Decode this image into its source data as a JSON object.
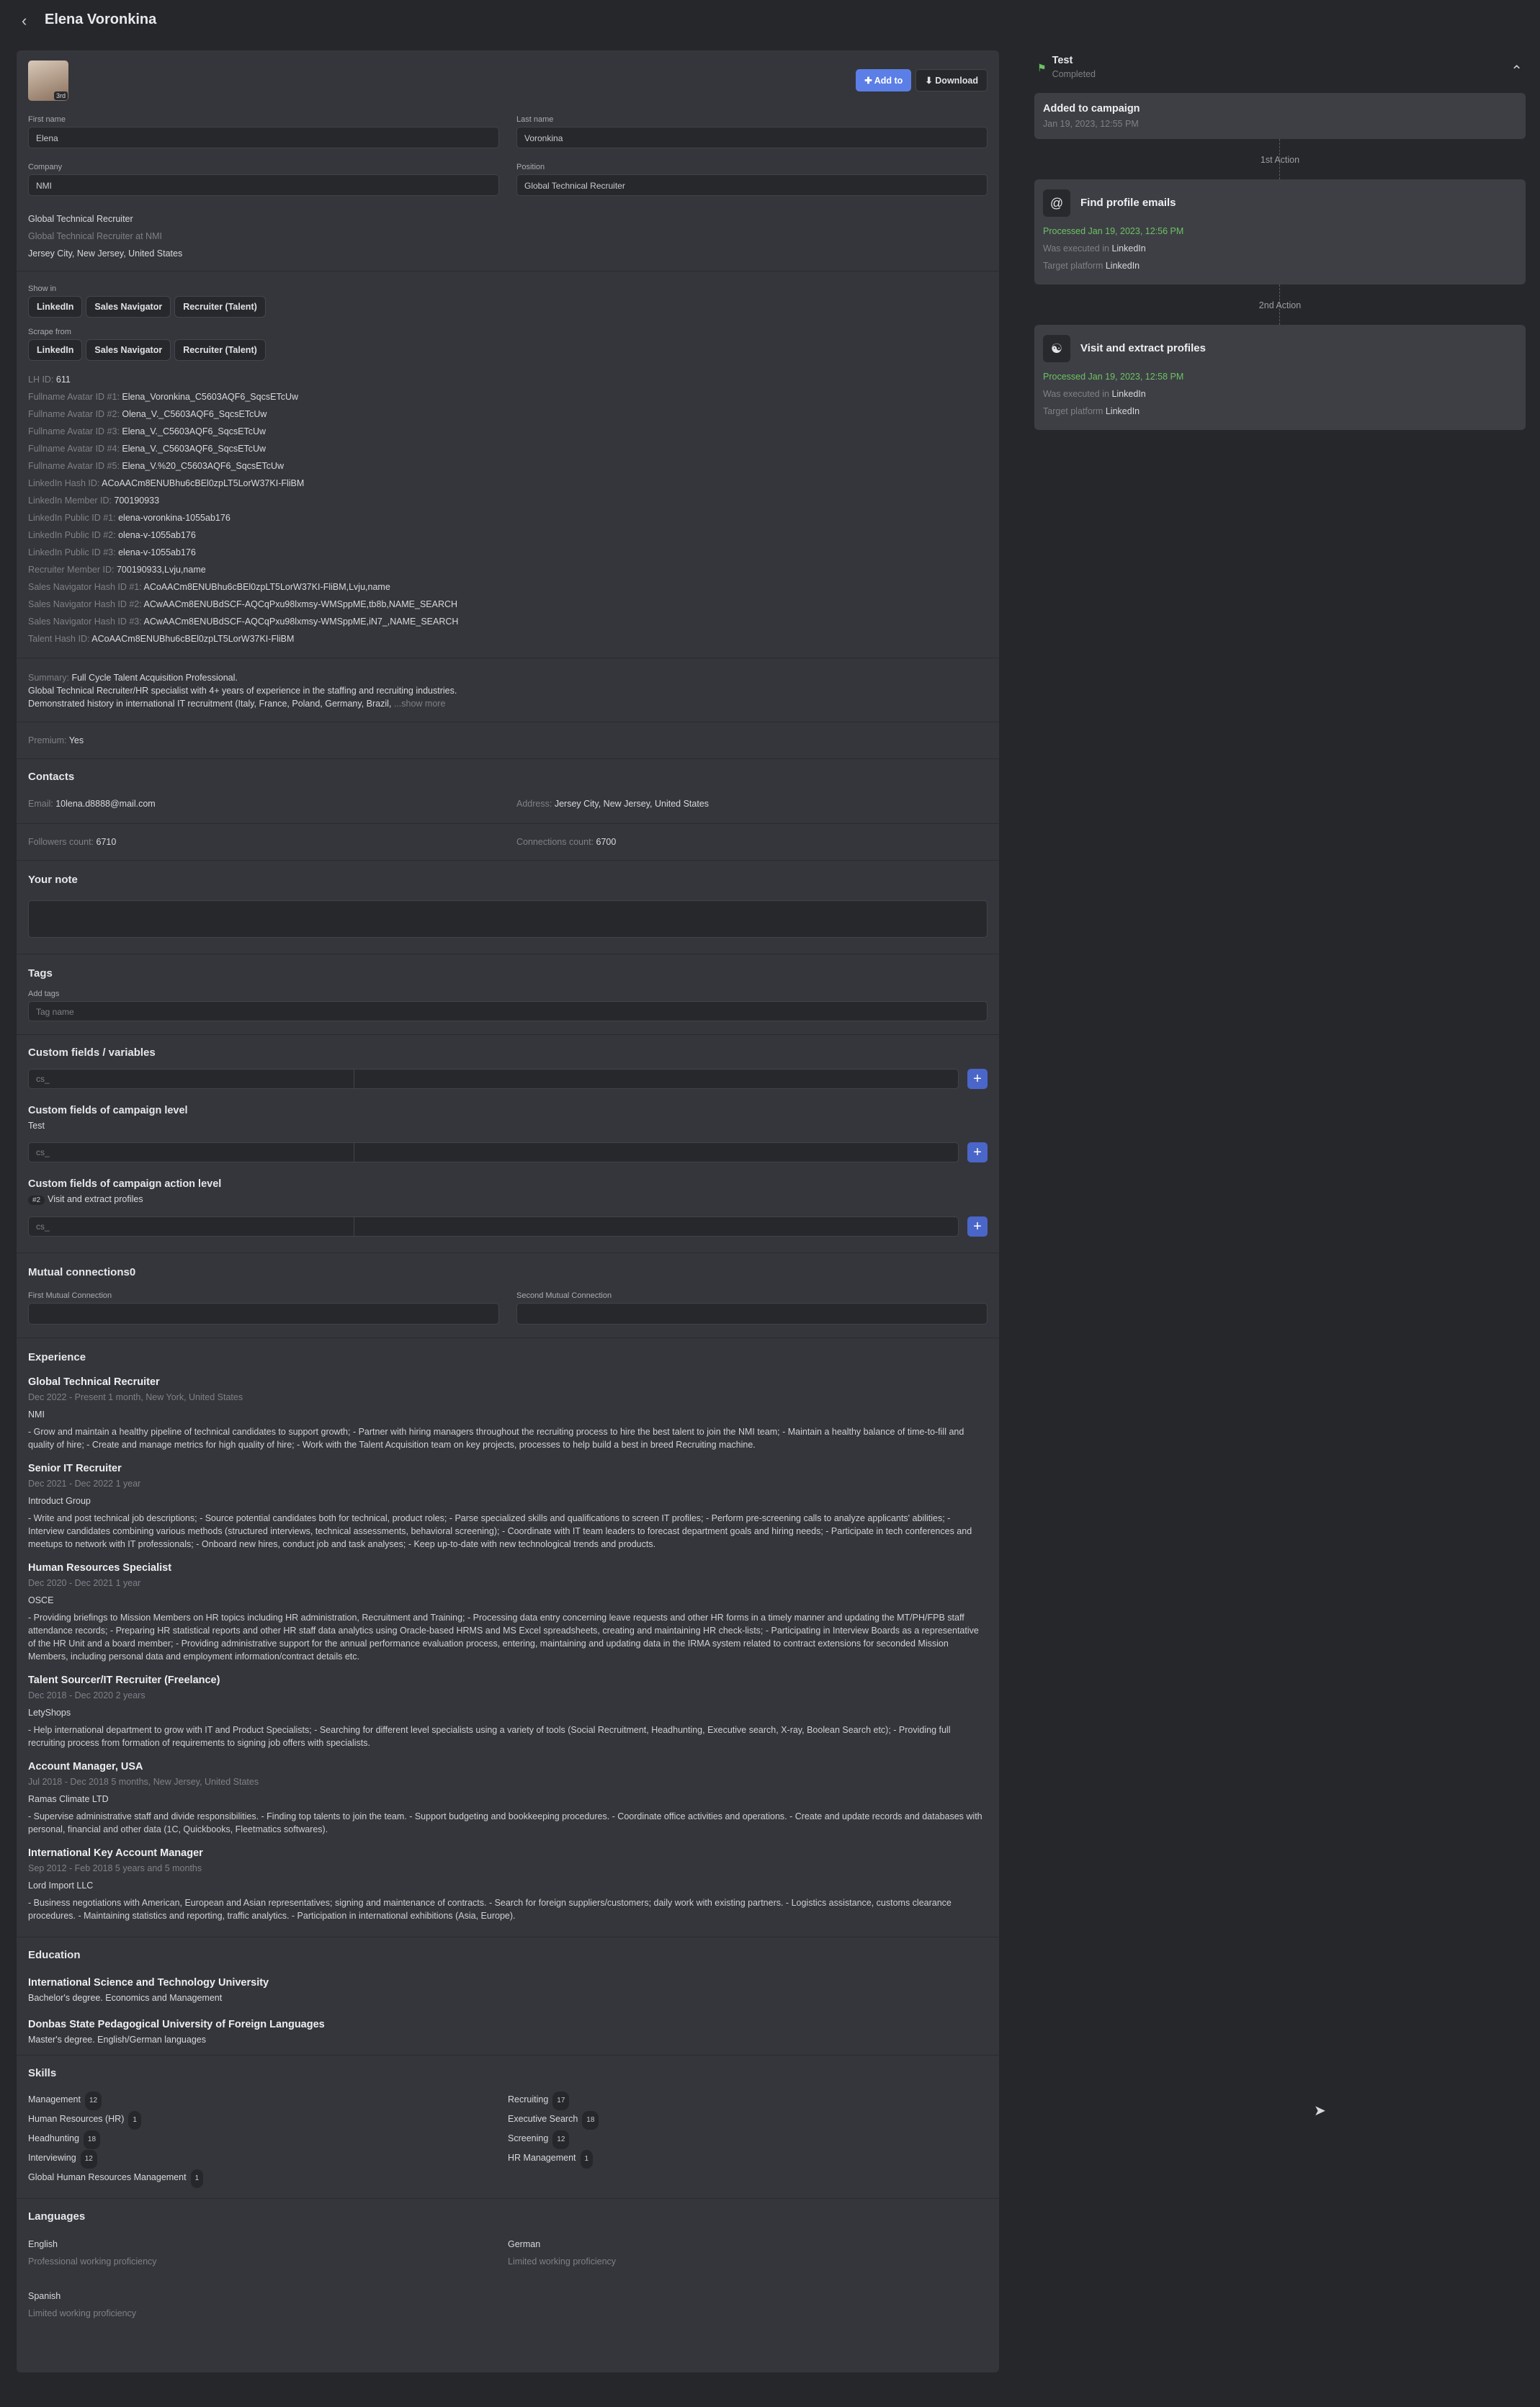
{
  "header": {
    "title": "Elena Voronkina"
  },
  "profile": {
    "degree": "3rd",
    "add_label": "Add to",
    "download_label": "Download",
    "first_name_label": "First name",
    "first_name": "Elena",
    "last_name_label": "Last name",
    "last_name": "Voronkina",
    "company_label": "Company",
    "company": "NMI",
    "position_label": "Position",
    "position": "Global Technical Recruiter",
    "headline": "Global Technical Recruiter",
    "headline_sub": "Global Technical Recruiter at NMI",
    "location": "Jersey City, New Jersey, United States"
  },
  "show_in": {
    "label": "Show in",
    "chips": [
      "LinkedIn",
      "Sales Navigator",
      "Recruiter (Talent)"
    ]
  },
  "scrape_from": {
    "label": "Scrape from",
    "chips": [
      "LinkedIn",
      "Sales Navigator",
      "Recruiter (Talent)"
    ]
  },
  "ids": [
    {
      "k": "LH ID:",
      "v": "611"
    },
    {
      "k": "Fullname Avatar ID #1:",
      "v": "Elena_Voronkina_C5603AQF6_SqcsETcUw"
    },
    {
      "k": "Fullname Avatar ID #2:",
      "v": "Olena_V._C5603AQF6_SqcsETcUw"
    },
    {
      "k": "Fullname Avatar ID #3:",
      "v": "Elena_V._C5603AQF6_SqcsETcUw"
    },
    {
      "k": "Fullname Avatar ID #4:",
      "v": "Elena_V._C5603AQF6_SqcsETcUw"
    },
    {
      "k": "Fullname Avatar ID #5:",
      "v": "Elena_V.%20_C5603AQF6_SqcsETcUw"
    },
    {
      "k": "LinkedIn Hash ID:",
      "v": "ACoAACm8ENUBhu6cBEl0zpLT5LorW37KI-FliBM"
    },
    {
      "k": "LinkedIn Member ID:",
      "v": "700190933"
    },
    {
      "k": "LinkedIn Public ID #1:",
      "v": "elena-voronkina-1055ab176"
    },
    {
      "k": "LinkedIn Public ID #2:",
      "v": "olena-v-1055ab176"
    },
    {
      "k": "LinkedIn Public ID #3:",
      "v": "elena-v-1055ab176"
    },
    {
      "k": "Recruiter Member ID:",
      "v": "700190933,Lvju,name"
    },
    {
      "k": "Sales Navigator Hash ID #1:",
      "v": "ACoAACm8ENUBhu6cBEl0zpLT5LorW37KI-FliBM,Lvju,name"
    },
    {
      "k": "Sales Navigator Hash ID #2:",
      "v": "ACwAACm8ENUBdSCF-AQCqPxu98lxmsy-WMSppME,tb8b,NAME_SEARCH"
    },
    {
      "k": "Sales Navigator Hash ID #3:",
      "v": "ACwAACm8ENUBdSCF-AQCqPxu98lxmsy-WMSppME,iN7_,NAME_SEARCH"
    },
    {
      "k": "Talent Hash ID:",
      "v": "ACoAACm8ENUBhu6cBEl0zpLT5LorW37KI-FliBM"
    }
  ],
  "summary": {
    "label": "Summary:",
    "line1": "Full Cycle Talent Acquisition Professional.",
    "line2": "Global Technical Recruiter/HR specialist with 4+ years of experience in the staffing and recruiting industries.",
    "line3": "Demonstrated history in international IT recruitment (Italy, France, Poland, Germany, Brazil,",
    "more": "...show more"
  },
  "premium": {
    "label": "Premium:",
    "value": "Yes"
  },
  "contacts": {
    "title": "Contacts",
    "email_label": "Email:",
    "email": "10lena.d8888@mail.com",
    "address_label": "Address:",
    "address": "Jersey City, New Jersey, United States",
    "followers_label": "Followers count:",
    "followers": "6710",
    "connections_label": "Connections count:",
    "connections": "6700"
  },
  "note": {
    "title": "Your note"
  },
  "tags": {
    "title": "Tags",
    "add_label": "Add tags",
    "placeholder": "Tag name"
  },
  "custom": {
    "title": "Custom fields / variables",
    "placeholder": "cs_",
    "campaign_title": "Custom fields of campaign level",
    "campaign_name": "Test",
    "action_title": "Custom fields of campaign action level",
    "action_badge": "#2",
    "action_name": "Visit and extract profiles"
  },
  "mutual": {
    "title": "Mutual connections",
    "count": "0",
    "first_label": "First Mutual Connection",
    "second_label": "Second Mutual Connection"
  },
  "experience": {
    "title": "Experience",
    "jobs": [
      {
        "title": "Global Technical Recruiter",
        "dates": "Dec 2022 - Present  1 month, New York, United States",
        "company": "NMI",
        "desc": "- Grow and maintain a healthy pipeline of technical candidates to support growth; - Partner with hiring managers throughout the recruiting process to hire the best talent to join the NMI team; - Maintain a healthy balance of time-to-fill and quality of hire; - Create and manage metrics for high quality of hire; - Work with the Talent Acquisition team on key projects, processes to help build a best in breed Recruiting machine."
      },
      {
        "title": "Senior IT Recruiter",
        "dates": "Dec 2021 - Dec 2022  1 year",
        "company": "Introduct Group",
        "desc": "- Write and post technical job descriptions; - Source potential candidates both for technical, product roles; - Parse specialized skills and qualifications to screen IT profiles; - Perform pre-screening calls to analyze applicants' abilities; - Interview candidates combining various methods (structured interviews, technical assessments, behavioral screening); - Coordinate with IT team leaders to forecast department goals and hiring needs; - Participate in tech conferences and meetups to network with IT professionals; - Onboard new hires, conduct job and task analyses; - Keep up-to-date with new technological trends and products."
      },
      {
        "title": "Human Resources Specialist",
        "dates": "Dec 2020 - Dec 2021  1 year",
        "company": "OSCE",
        "desc": "- Providing briefings to Mission Members on HR topics including HR administration, Recruitment and Training; - Processing data entry concerning leave requests and other HR forms in a timely manner and updating the MT/PH/FPB staff attendance records; - Preparing HR statistical reports and other HR staff data analytics using Oracle-based HRMS and MS Excel spreadsheets, creating and maintaining HR check-lists; - Participating in Interview Boards as a representative of the HR Unit and a board member; - Providing administrative support for the annual performance evaluation process, entering, maintaining and updating data in the IRMA system related to contract extensions for seconded Mission Members, including personal data and employment information/contract details etc."
      },
      {
        "title": "Talent Sourcer/IT Recruiter (Freelance)",
        "dates": "Dec 2018 - Dec 2020  2 years",
        "company": "LetyShops",
        "desc": "- Help international department to grow with IT and Product Specialists; - Searching for different level specialists using a variety of tools (Social Recruitment, Headhunting, Executive search, X-ray, Boolean Search etc); - Providing full recruiting process from formation of requirements to signing job offers with specialists."
      },
      {
        "title": "Account Manager, USA",
        "dates": "Jul 2018 - Dec 2018  5 months, New Jersey, United States",
        "company": "Ramas Climate LTD",
        "desc": "- Supervise administrative staff and divide responsibilities. - Finding top talents to join the team. - Support budgeting and bookkeeping procedures. - Coordinate office activities and operations. - Create and update records and databases with personal, financial and other data (1C, Quickbooks, Fleetmatics softwares)."
      },
      {
        "title": "International Key Account Manager",
        "dates": "Sep 2012 - Feb 2018  5 years and 5 months",
        "company": "Lord Import LLC",
        "desc": "- Business negotiations with American, European and Asian representatives; signing and maintenance of contracts. - Search for foreign suppliers/customers; daily work with existing partners. - Logistics assistance, customs clearance procedures. - Maintaining statistics and reporting, traffic analytics. - Participation in international exhibitions (Asia, Europe)."
      }
    ]
  },
  "education": {
    "title": "Education",
    "items": [
      {
        "school": "International Science and Technology University",
        "degree": "Bachelor's degree. Economics and Management"
      },
      {
        "school": "Donbas State Pedagogical University of Foreign Languages",
        "degree": "Master's degree. English/German languages"
      }
    ]
  },
  "skills": {
    "title": "Skills",
    "items": [
      {
        "name": "Management",
        "count": "12"
      },
      {
        "name": "Recruiting",
        "count": "17"
      },
      {
        "name": "Human Resources (HR)",
        "count": "1"
      },
      {
        "name": "Executive Search",
        "count": "18"
      },
      {
        "name": "Headhunting",
        "count": "18"
      },
      {
        "name": "Screening",
        "count": "12"
      },
      {
        "name": "Interviewing",
        "count": "12"
      },
      {
        "name": "HR Management",
        "count": "1"
      },
      {
        "name": "Global Human Resources Management",
        "count": "1"
      }
    ]
  },
  "languages": {
    "title": "Languages",
    "items": [
      {
        "name": "English",
        "level": "Professional working proficiency"
      },
      {
        "name": "German",
        "level": "Limited working proficiency"
      },
      {
        "name": "Spanish",
        "level": "Limited working proficiency"
      }
    ]
  },
  "campaign": {
    "name": "Test",
    "status": "Completed",
    "added_title": "Added to campaign",
    "added_date": "Jan 19, 2023, 12:55 PM",
    "sep1": "1st Action",
    "sep2": "2nd Action",
    "actions": [
      {
        "name": "Find profile emails",
        "processed": "Processed Jan 19, 2023, 12:56 PM",
        "exec_label": "Was executed in",
        "exec": "LinkedIn",
        "target_label": "Target platform",
        "target": "LinkedIn"
      },
      {
        "name": "Visit and extract profiles",
        "processed": "Processed Jan 19, 2023, 12:58 PM",
        "exec_label": "Was executed in",
        "exec": "LinkedIn",
        "target_label": "Target platform",
        "target": "LinkedIn"
      }
    ]
  },
  "colors": {
    "background": "#26272b",
    "panel": "#35363b",
    "accent": "#4a66c9",
    "success": "#6cc262"
  }
}
